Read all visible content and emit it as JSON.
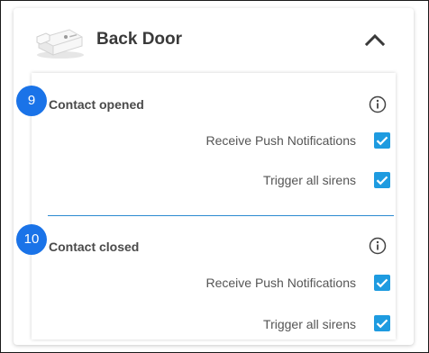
{
  "device": {
    "name": "Back Door",
    "image_icon": "door-contact-sensor-icon",
    "collapse_icon": "chevron-up-icon"
  },
  "sections": [
    {
      "step": "9",
      "title": "Contact opened",
      "info_icon": "info-icon",
      "options": [
        {
          "label": "Receive Push Notifications",
          "checked": true
        },
        {
          "label": "Trigger all sirens",
          "checked": true
        }
      ]
    },
    {
      "step": "10",
      "title": "Contact closed",
      "info_icon": "info-icon",
      "options": [
        {
          "label": "Receive Push Notifications",
          "checked": true
        },
        {
          "label": "Trigger all sirens",
          "checked": true
        }
      ]
    }
  ],
  "colors": {
    "checkbox": "#1e9be0",
    "divider": "#2c8ad0",
    "step_badge": "#1a73e8"
  }
}
